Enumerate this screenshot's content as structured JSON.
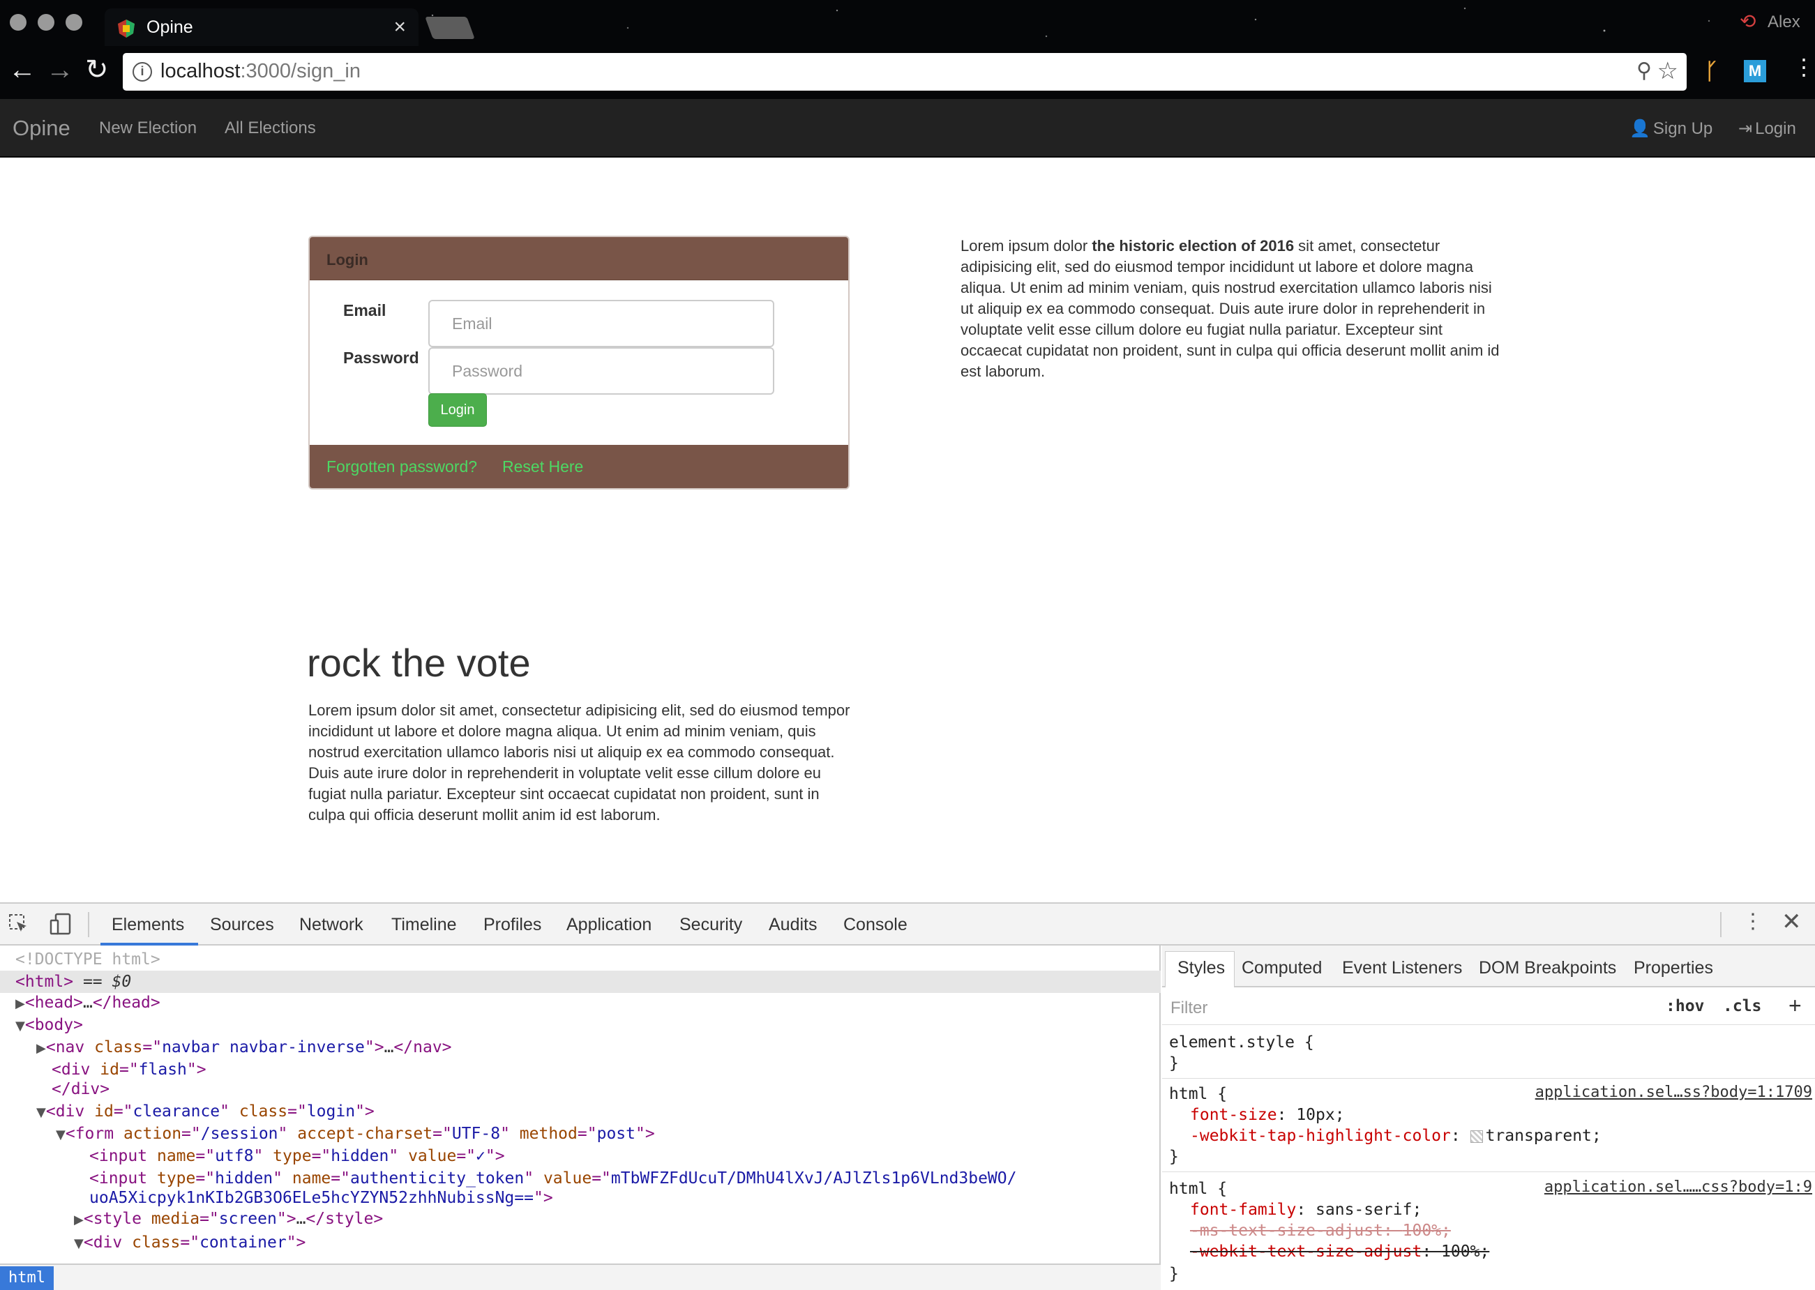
{
  "browser": {
    "tab_title": "Opine",
    "tab_close": "×",
    "url_host": "localhost",
    "url_path": ":3000/sign_in",
    "profile_name": "Alex",
    "extension_m": "M"
  },
  "navbar": {
    "brand": "Opine",
    "links": [
      "New Election",
      "All Elections"
    ],
    "sign_up": "Sign Up",
    "login": "Login"
  },
  "login_panel": {
    "title": "Login",
    "email_label": "Email",
    "email_placeholder": "Email",
    "password_label": "Password",
    "password_placeholder": "Password",
    "submit_label": "Login",
    "forgot_text": "Forgotten password?",
    "reset_link": "Reset Here"
  },
  "side_text": {
    "before": "Lorem ipsum dolor ",
    "bold": "the historic election of 2016",
    "after": " sit amet, consectetur adipisicing elit, sed do eiusmod tempor incididunt ut labore et dolore magna aliqua. Ut enim ad minim veniam, quis nostrud exercitation ullamco laboris nisi ut aliquip ex ea commodo consequat. Duis aute irure dolor in reprehenderit in voluptate velit esse cillum dolore eu fugiat nulla pariatur. Excepteur sint occaecat cupidatat non proident, sunt in culpa qui officia deserunt mollit anim id est laborum."
  },
  "section": {
    "heading": "rock the vote",
    "body": "Lorem ipsum dolor sit amet, consectetur adipisicing elit, sed do eiusmod tempor incididunt ut labore et dolore magna aliqua. Ut enim ad minim veniam, quis nostrud exercitation ullamco laboris nisi ut aliquip ex ea commodo consequat. Duis aute irure dolor in reprehenderit in voluptate velit esse cillum dolore eu fugiat nulla pariatur. Excepteur sint occaecat cupidatat non proident, sunt in culpa qui officia deserunt mollit anim id est laborum."
  },
  "devtools": {
    "tabs": [
      "Elements",
      "Sources",
      "Network",
      "Timeline",
      "Profiles",
      "Application",
      "Security",
      "Audits",
      "Console"
    ],
    "active_tab": "Elements",
    "dom": {
      "doctype": "<!DOCTYPE html>",
      "html_open": "html",
      "html_marker": " == $0",
      "head": "head",
      "head_ellipsis": "…",
      "body": "body",
      "nav_tag": "nav",
      "nav_class": "navbar navbar-inverse",
      "flash_tag": "div",
      "flash_id": "flash",
      "div_close": "div",
      "clearance_tag": "div",
      "clearance_id": "clearance",
      "clearance_class": "login",
      "form_tag": "form",
      "form_action": "/session",
      "form_charset": "UTF-8",
      "form_method": "post",
      "input_tag": "input",
      "utf8_name": "utf8",
      "utf8_type": "hidden",
      "utf8_value": "✓",
      "token_type": "hidden",
      "token_name": "authenticity_token",
      "token_value_1": "mTbWFZFdUcuT/DMhU4lXvJ/AJlZls1p6VLnd3beWO/",
      "token_value_2": "uoA5Xicpyk1nKIb2GB3O6ELe5hcYZYN52zhhNubissNg==",
      "style_tag": "style",
      "style_media": "screen",
      "container_tag": "div",
      "container_class": "container"
    },
    "breadcrumb": "html",
    "styles_tabs": [
      "Styles",
      "Computed",
      "Event Listeners",
      "DOM Breakpoints",
      "Properties"
    ],
    "filter_placeholder": "Filter",
    "hov": ":hov",
    "cls": ".cls",
    "element_style": "element.style {",
    "close_brace": "}",
    "rule1": {
      "selector": "html {",
      "source": "application.sel…ss?body=1:1709",
      "prop1": "font-size",
      "val1": "10px;",
      "prop2": "-webkit-tap-highlight-color",
      "val2": "transparent;"
    },
    "rule2": {
      "selector": "html {",
      "source": "application.sel……css?body=1:9",
      "prop1": "font-family",
      "val1": "sans-serif;",
      "prop2": "-ms-text-size-adjust",
      "val2": "100%;",
      "prop3": "-webkit-text-size-adjust",
      "val3": "100%;"
    }
  }
}
